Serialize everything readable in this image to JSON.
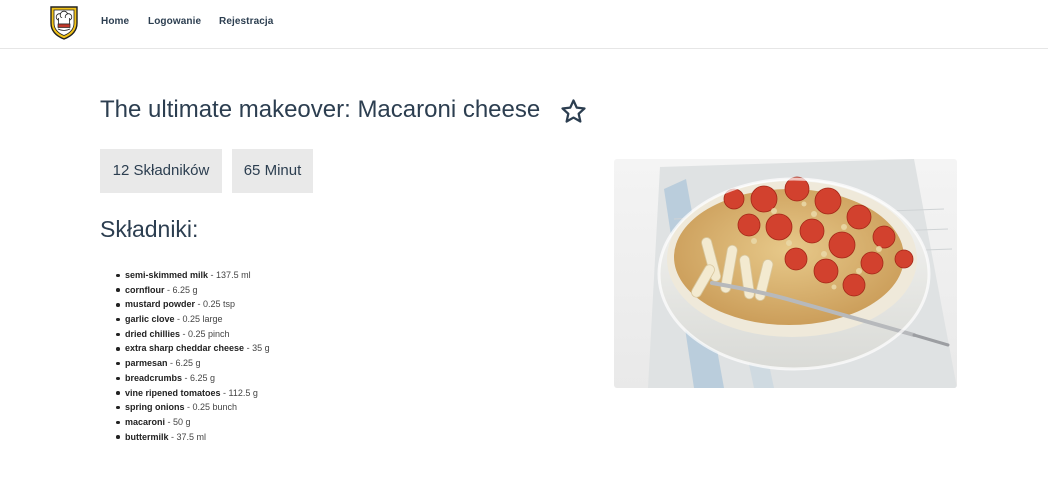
{
  "nav": {
    "items": [
      {
        "label": "Home"
      },
      {
        "label": "Logowanie"
      },
      {
        "label": "Rejestracja"
      }
    ]
  },
  "recipe": {
    "title": "The ultimate makeover: Macaroni cheese",
    "ingredients_badge": "12 Składników",
    "time_badge": "65 Minut",
    "ingredients_heading": "Składniki:",
    "ingredients": [
      {
        "name": "semi-skimmed milk",
        "qty": "137.5 ml"
      },
      {
        "name": "cornflour",
        "qty": "6.25 g"
      },
      {
        "name": "mustard powder",
        "qty": "0.25 tsp"
      },
      {
        "name": "garlic clove",
        "qty": "0.25 large"
      },
      {
        "name": "dried chillies",
        "qty": "0.25 pinch"
      },
      {
        "name": "extra sharp cheddar cheese",
        "qty": "35 g"
      },
      {
        "name": "parmesan",
        "qty": "6.25 g"
      },
      {
        "name": "breadcrumbs",
        "qty": "6.25 g"
      },
      {
        "name": "vine ripened tomatoes",
        "qty": "112.5 g"
      },
      {
        "name": "spring onions",
        "qty": "0.25 bunch"
      },
      {
        "name": "macaroni",
        "qty": "50 g"
      },
      {
        "name": "buttermilk",
        "qty": "37.5 ml"
      }
    ]
  },
  "icons": {
    "logo": "chef-hat-shield-logo",
    "favorite": "star-outline-icon"
  },
  "colors": {
    "text": "#2c3e50",
    "badge_bg": "#e9e9e9",
    "logo_gold": "#f2c318"
  }
}
